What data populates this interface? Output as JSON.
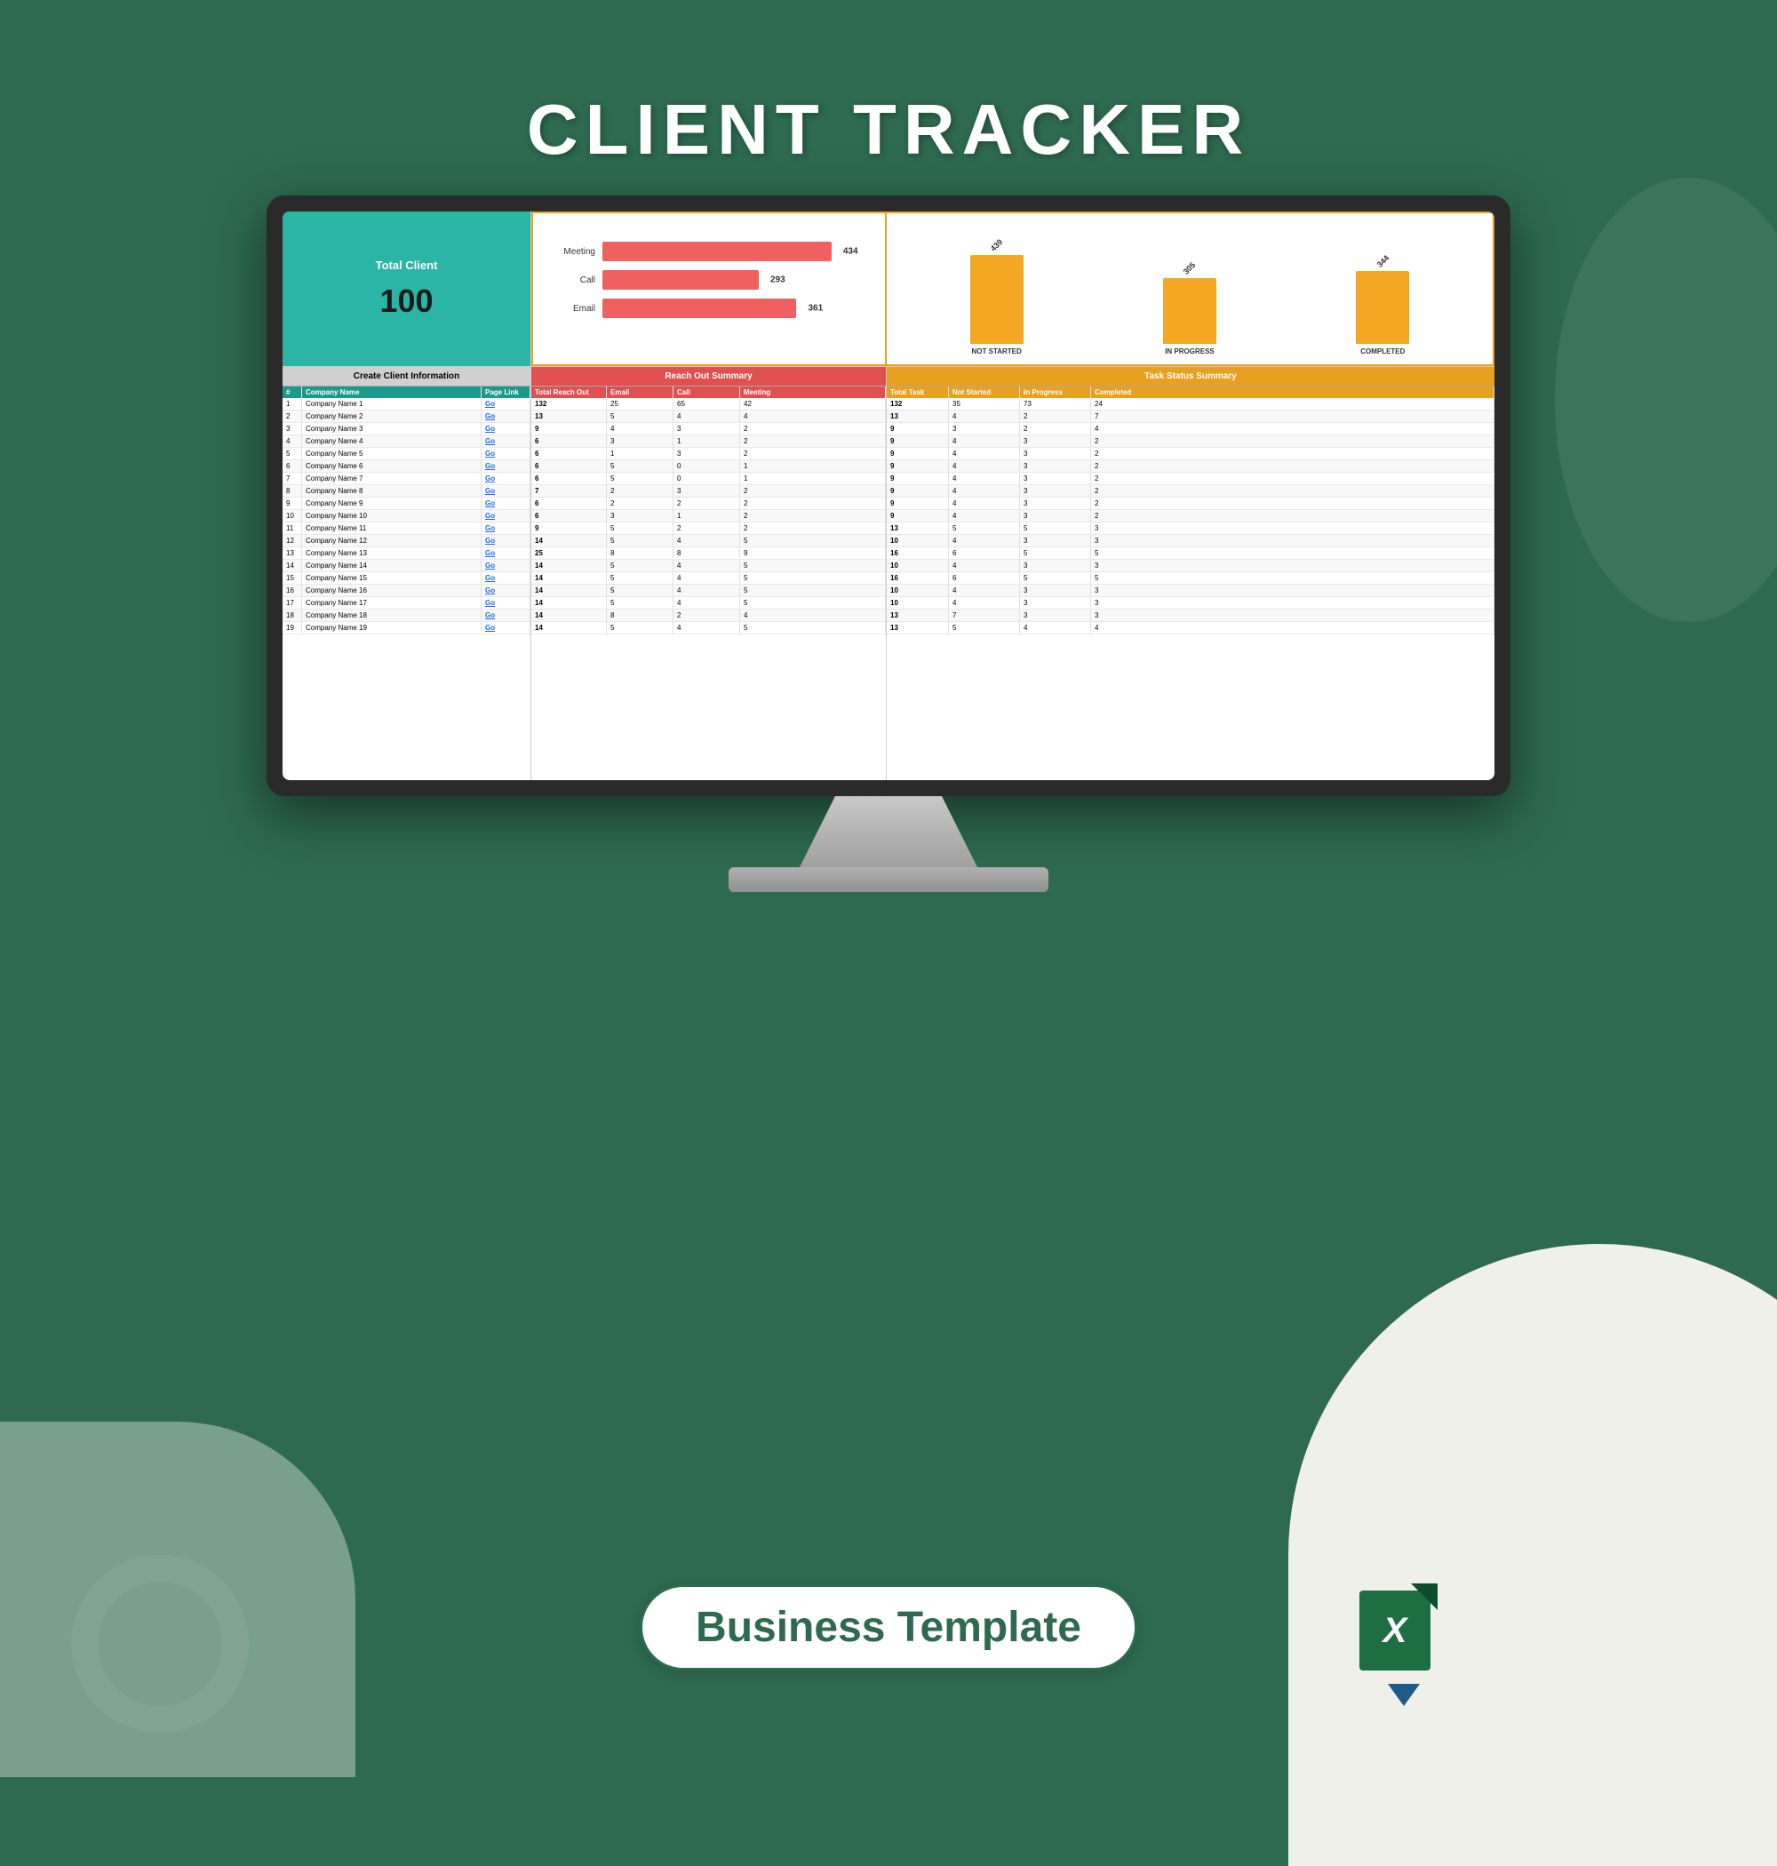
{
  "page": {
    "title": "CLIENT TRACKER",
    "bottom_label": "Business Template",
    "background_color": "#2d6a4f"
  },
  "summary": {
    "total_client_label": "Total Client",
    "total_client_value": "100",
    "reach_out": {
      "title": "Reach Out Summary",
      "bars": [
        {
          "label": "Meeting",
          "value": 434,
          "width_pct": 90
        },
        {
          "label": "Call",
          "value": 293,
          "width_pct": 60
        },
        {
          "label": "Email",
          "value": 361,
          "width_pct": 75
        }
      ]
    },
    "task_status": {
      "title": "Task Status Summary",
      "bars": [
        {
          "label": "NOT STARTED",
          "value": "439",
          "height": 100
        },
        {
          "label": "IN PROGRESS",
          "value": "305",
          "height": 75
        },
        {
          "label": "COMPLETED",
          "value": "344",
          "height": 82
        }
      ]
    }
  },
  "table": {
    "left_section_title": "Create Client Information",
    "left_headers": [
      "#",
      "Company Name",
      "Page Link"
    ],
    "middle_section_title": "Reach Out Summary",
    "middle_headers": [
      "Total Reach Out",
      "Email",
      "Call",
      "Meeting"
    ],
    "right_section_title": "Task Status Summary",
    "right_headers": [
      "Total Task",
      "Not Started",
      "In Progress",
      "Completed"
    ],
    "rows": [
      {
        "num": 1,
        "name": "Company Name 1",
        "reach_total": 132,
        "email": 25,
        "call": 65,
        "meeting": 42,
        "task_total": 132,
        "not_started": 35,
        "in_progress": 73,
        "completed": 24
      },
      {
        "num": 2,
        "name": "Company Name 2",
        "reach_total": 13,
        "email": 5,
        "call": 4,
        "meeting": 4,
        "task_total": 13,
        "not_started": 4,
        "in_progress": 2,
        "completed": 7
      },
      {
        "num": 3,
        "name": "Company Name 3",
        "reach_total": 9,
        "email": 4,
        "call": 3,
        "meeting": 2,
        "task_total": 9,
        "not_started": 3,
        "in_progress": 2,
        "completed": 4
      },
      {
        "num": 4,
        "name": "Company Name 4",
        "reach_total": 6,
        "email": 3,
        "call": 1,
        "meeting": 2,
        "task_total": 9,
        "not_started": 4,
        "in_progress": 3,
        "completed": 2
      },
      {
        "num": 5,
        "name": "Company Name 5",
        "reach_total": 6,
        "email": 1,
        "call": 3,
        "meeting": 2,
        "task_total": 9,
        "not_started": 4,
        "in_progress": 3,
        "completed": 2
      },
      {
        "num": 6,
        "name": "Company Name 6",
        "reach_total": 6,
        "email": 5,
        "call": 0,
        "meeting": 1,
        "task_total": 9,
        "not_started": 4,
        "in_progress": 3,
        "completed": 2
      },
      {
        "num": 7,
        "name": "Company Name 7",
        "reach_total": 6,
        "email": 5,
        "call": 0,
        "meeting": 1,
        "task_total": 9,
        "not_started": 4,
        "in_progress": 3,
        "completed": 2
      },
      {
        "num": 8,
        "name": "Company Name 8",
        "reach_total": 7,
        "email": 2,
        "call": 3,
        "meeting": 2,
        "task_total": 9,
        "not_started": 4,
        "in_progress": 3,
        "completed": 2
      },
      {
        "num": 9,
        "name": "Company Name 9",
        "reach_total": 6,
        "email": 2,
        "call": 2,
        "meeting": 2,
        "task_total": 9,
        "not_started": 4,
        "in_progress": 3,
        "completed": 2
      },
      {
        "num": 10,
        "name": "Company Name 10",
        "reach_total": 6,
        "email": 3,
        "call": 1,
        "meeting": 2,
        "task_total": 9,
        "not_started": 4,
        "in_progress": 3,
        "completed": 2
      },
      {
        "num": 11,
        "name": "Company Name 11",
        "reach_total": 9,
        "email": 5,
        "call": 2,
        "meeting": 2,
        "task_total": 13,
        "not_started": 5,
        "in_progress": 5,
        "completed": 3
      },
      {
        "num": 12,
        "name": "Company Name 12",
        "reach_total": 14,
        "email": 5,
        "call": 4,
        "meeting": 5,
        "task_total": 10,
        "not_started": 4,
        "in_progress": 3,
        "completed": 3
      },
      {
        "num": 13,
        "name": "Company Name 13",
        "reach_total": 25,
        "email": 8,
        "call": 8,
        "meeting": 9,
        "task_total": 16,
        "not_started": 6,
        "in_progress": 5,
        "completed": 5
      },
      {
        "num": 14,
        "name": "Company Name 14",
        "reach_total": 14,
        "email": 5,
        "call": 4,
        "meeting": 5,
        "task_total": 10,
        "not_started": 4,
        "in_progress": 3,
        "completed": 3
      },
      {
        "num": 15,
        "name": "Company Name 15",
        "reach_total": 14,
        "email": 5,
        "call": 4,
        "meeting": 5,
        "task_total": 16,
        "not_started": 6,
        "in_progress": 5,
        "completed": 5
      },
      {
        "num": 16,
        "name": "Company Name 16",
        "reach_total": 14,
        "email": 5,
        "call": 4,
        "meeting": 5,
        "task_total": 10,
        "not_started": 4,
        "in_progress": 3,
        "completed": 3
      },
      {
        "num": 17,
        "name": "Company Name 17",
        "reach_total": 14,
        "email": 5,
        "call": 4,
        "meeting": 5,
        "task_total": 10,
        "not_started": 4,
        "in_progress": 3,
        "completed": 3
      },
      {
        "num": 18,
        "name": "Company Name 18",
        "reach_total": 14,
        "email": 8,
        "call": 2,
        "meeting": 4,
        "task_total": 13,
        "not_started": 7,
        "in_progress": 3,
        "completed": 3
      },
      {
        "num": 19,
        "name": "Company Name 19",
        "reach_total": 14,
        "email": 5,
        "call": 4,
        "meeting": 5,
        "task_total": 13,
        "not_started": 5,
        "in_progress": 4,
        "completed": 4
      }
    ]
  },
  "excel_icon": {
    "letter": "X",
    "title": "Excel Icon"
  }
}
